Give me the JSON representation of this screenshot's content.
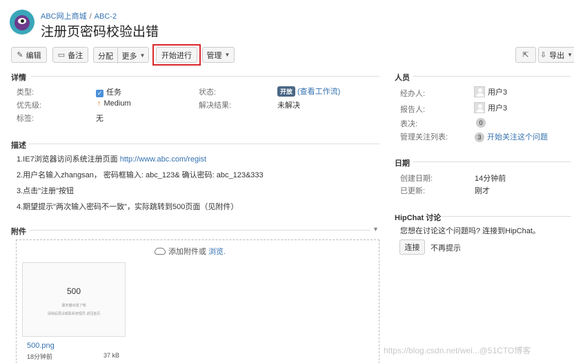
{
  "breadcrumb": {
    "project": "ABC网上商城",
    "sep": "/",
    "issue_key": "ABC-2"
  },
  "title": "注册页密码校验出错",
  "toolbar": {
    "edit": "编辑",
    "comment": "备注",
    "assign": "分配",
    "more": "更多",
    "start_progress": "开始进行",
    "admin": "管理",
    "export": "导出"
  },
  "details": {
    "heading": "详情",
    "type_label": "类型:",
    "type_value": "任务",
    "priority_label": "优先级:",
    "priority_value": "Medium",
    "labels_label": "标签:",
    "labels_value": "无",
    "status_label": "状态:",
    "status_value": "开放",
    "status_link": "(查看工作流)",
    "resolution_label": "解决结果:",
    "resolution_value": "未解决"
  },
  "description": {
    "heading": "描述",
    "lines": [
      "1.IE7浏览器访问系统注册页面",
      "2.用户名输入zhangsan， 密码框输入: abc_123& 确认密码: abc_123&333",
      "3.点击\"注册\"按钮",
      "4.期望提示\"两次输入密码不一致\"，实际跳转到500页面（见附件）"
    ],
    "url": "http://www.abc.com/regist"
  },
  "attachments": {
    "heading": "附件",
    "upload_text": "添加附件或",
    "browse_link": "浏览.",
    "thumb_big": "500",
    "thumb_line1": "服务器出错了哦",
    "thumb_line2": "请稍后再试或联系管理员 返回首页",
    "file_name": "500.png",
    "file_time": "18分钟前",
    "file_size": "37 kB"
  },
  "people": {
    "heading": "人员",
    "assignee_label": "经办人:",
    "assignee_value": "用户3",
    "reporter_label": "报告人:",
    "reporter_value": "用户3",
    "votes_label": "表决:",
    "votes_value": "0",
    "watchers_label": "管理关注列表:",
    "watchers_count": "3",
    "watchers_link": "开始关注这个问题"
  },
  "dates": {
    "heading": "日期",
    "created_label": "创建日期:",
    "created_value": "14分钟前",
    "updated_label": "已更新:",
    "updated_value": "刚才"
  },
  "hipchat": {
    "heading": "HipChat 讨论",
    "prompt": "您想在讨论这个问题吗? 连接到HipChat。",
    "connect": "连接",
    "dismiss": "不再提示"
  },
  "watermark": "https://blog.csdn.net/wei...@51CTO博客"
}
